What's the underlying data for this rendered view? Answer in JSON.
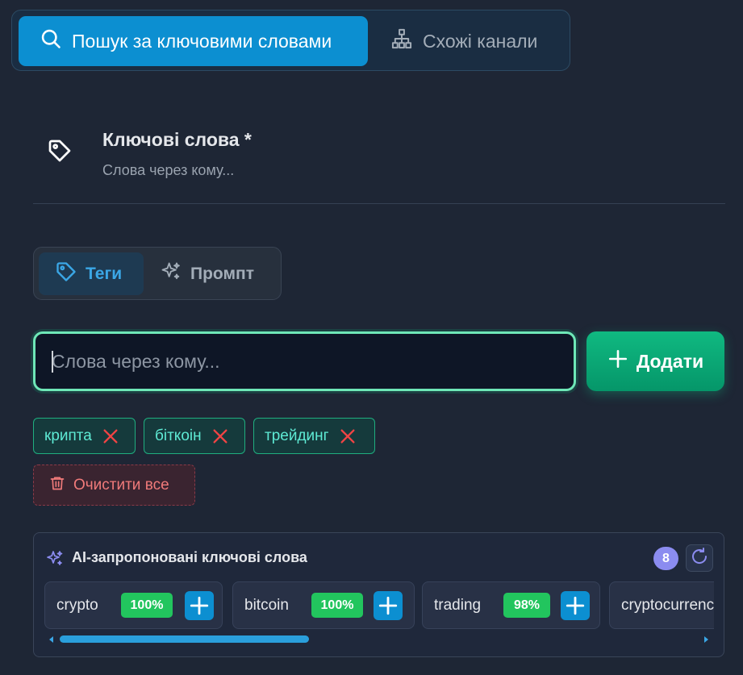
{
  "mode_switch": {
    "keyword_search_label": "Пошук за ключовими словами",
    "similar_channels_label": "Схожі канали"
  },
  "keywords_section": {
    "title": "Ключові слова *",
    "subtitle": "Слова через кому..."
  },
  "input_mode_tabs": {
    "tags_label": "Теги",
    "prompt_label": "Промпт"
  },
  "keyword_input": {
    "placeholder": "Слова через кому...",
    "value": ""
  },
  "add_button": {
    "label": "Додати"
  },
  "tags": [
    {
      "label": "крипта"
    },
    {
      "label": "біткоін"
    },
    {
      "label": "трейдинг"
    }
  ],
  "clear_all": {
    "label": "Очистити все"
  },
  "ai_suggestions": {
    "title": "AI-запропоновані ключові слова",
    "count": "8",
    "items": [
      {
        "word": "crypto",
        "score": "100%"
      },
      {
        "word": "bitcoin",
        "score": "100%"
      },
      {
        "word": "trading",
        "score": "98%"
      },
      {
        "word": "cryptocurrency",
        "score": ""
      }
    ]
  },
  "colors": {
    "background": "#1e2635",
    "accent_blue": "#0c8fd1",
    "accent_green": "#10b981",
    "tag_text": "#5eead4",
    "danger": "#f07a7a",
    "score_badge": "#22c55e",
    "count_badge": "#8b8cf0"
  },
  "icons": {
    "keyword_search": "search-icon",
    "similar_channels": "sitemap-icon",
    "keywords": "tag-icon",
    "tags_tab": "tag-icon",
    "prompt_tab": "sparkles-icon",
    "add": "plus-icon",
    "tag_remove": "close-icon",
    "clear_all": "trash-icon",
    "ai": "sparkles-icon",
    "refresh": "refresh-icon",
    "suggestion_add": "plus-icon"
  }
}
